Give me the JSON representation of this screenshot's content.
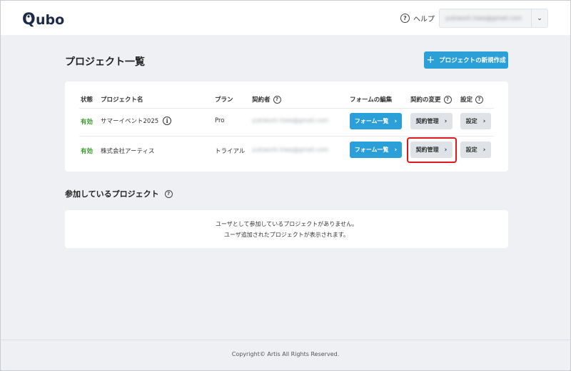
{
  "header": {
    "logo_text": "Qubo",
    "help_label": "ヘルプ",
    "account_email": "yukiwork.hiwa@gmail.com"
  },
  "main": {
    "title": "プロジェクト一覧",
    "new_button_label": "プロジェクトの新規作成",
    "columns": [
      "状態",
      "プロジェクト名",
      "プラン",
      "契約者",
      "フォームの編集",
      "契約の変更",
      "設定"
    ],
    "rows": [
      {
        "status": "有効",
        "name": "サマーイベント2025",
        "plan": "Pro",
        "contractor_email": "yukiwork.hiwa@gmail.com",
        "form_button": "フォーム一覧",
        "contract_button": "契約管理",
        "settings_button": "設定"
      },
      {
        "status": "有効",
        "name": "株式会社アーティス",
        "plan": "トライアル",
        "contractor_email": "yukiwork.hiwa@gmail.com",
        "form_button": "フォーム一覧",
        "contract_button": "契約管理",
        "settings_button": "設定"
      }
    ]
  },
  "participating": {
    "title": "参加しているプロジェクト",
    "empty_line1": "ユーザとして参加しているプロジェクトがありません。",
    "empty_line2": "ユーザ追加されたプロジェクトが表示されます。"
  },
  "footer": {
    "copyright": "Copyright© Artis All Rights Reserved."
  },
  "colors": {
    "accent": "#2a9fd8",
    "status_active": "#3a9a2e",
    "highlight": "#e0171c",
    "background": "#eef0f3"
  }
}
